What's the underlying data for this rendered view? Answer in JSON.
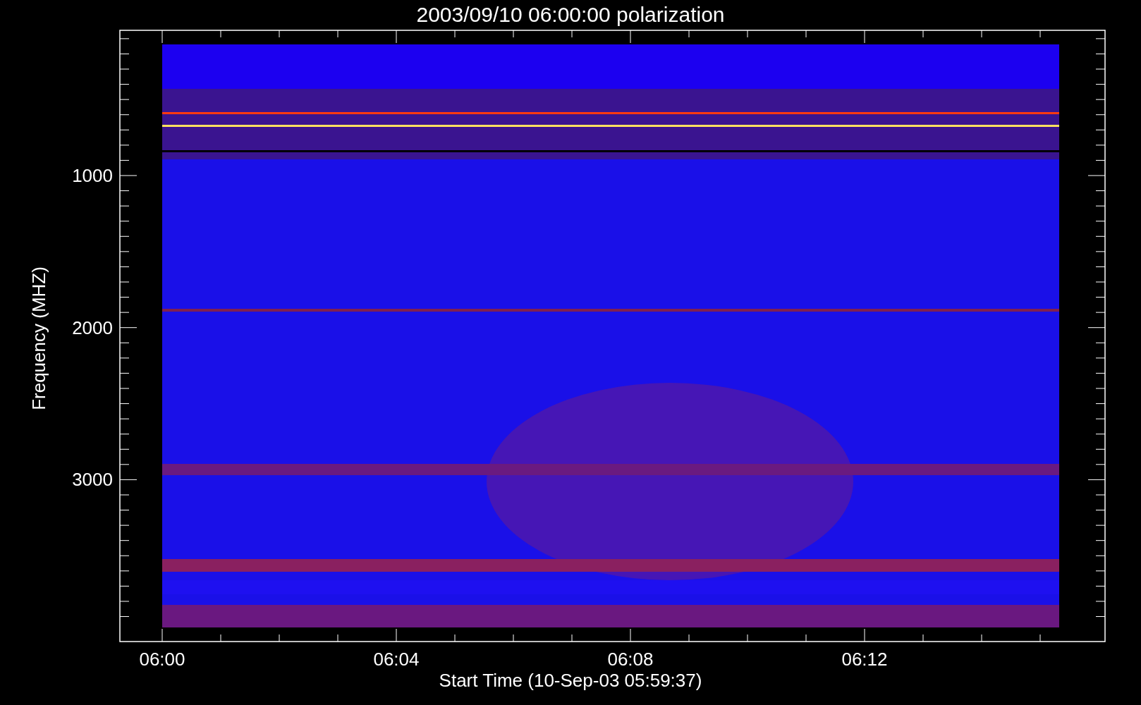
{
  "title": "2003/09/10 06:00:00 polarization",
  "y_axis": {
    "label": "Frequency (MHZ)",
    "ticks": [
      "1000",
      "2000",
      "3000"
    ]
  },
  "x_axis": {
    "label": "Start Time (10-Sep-03 05:59:37)",
    "ticks": [
      "06:00",
      "06:04",
      "06:08",
      "06:12"
    ]
  }
}
